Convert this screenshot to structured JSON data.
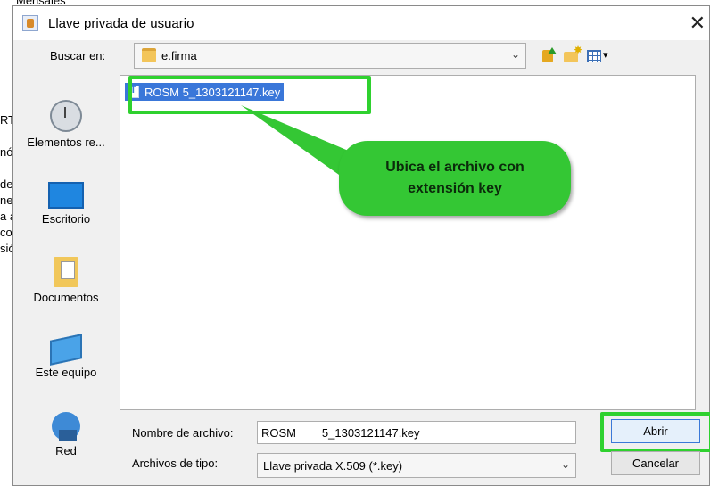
{
  "background": {
    "top_text": "Mensales",
    "side_fragments": [
      "RT.",
      "nó",
      "de",
      "ner",
      "a á",
      "cor",
      "sió"
    ]
  },
  "dialog": {
    "title": "Llave privada de usuario",
    "close_symbol": "✕"
  },
  "lookin": {
    "label": "Buscar en:",
    "value": "e.firma",
    "arrow": "⌄"
  },
  "places": [
    {
      "label": "Elementos re...",
      "icon": "recent-items-icon"
    },
    {
      "label": "Escritorio",
      "icon": "desktop-icon"
    },
    {
      "label": "Documentos",
      "icon": "documents-icon"
    },
    {
      "label": "Este equipo",
      "icon": "computer-icon"
    },
    {
      "label": "Red",
      "icon": "network-icon"
    }
  ],
  "files": [
    {
      "name": "ROSM        5_1303121147.key",
      "icon": "key-file-icon",
      "selected": true
    }
  ],
  "callout": {
    "line1": "Ubica el archivo con",
    "line2": "extensión key",
    "color": "#34c734"
  },
  "filename": {
    "label": "Nombre de archivo:",
    "value": "ROSM        5_1303121147.key"
  },
  "filetype": {
    "label": "Archivos de tipo:",
    "value": "Llave privada X.509 (*.key)",
    "arrow": "⌄"
  },
  "buttons": {
    "open": "Abrir",
    "cancel": "Cancelar"
  },
  "highlight_color": "#2fd12f",
  "selection_color": "#3a77d9"
}
